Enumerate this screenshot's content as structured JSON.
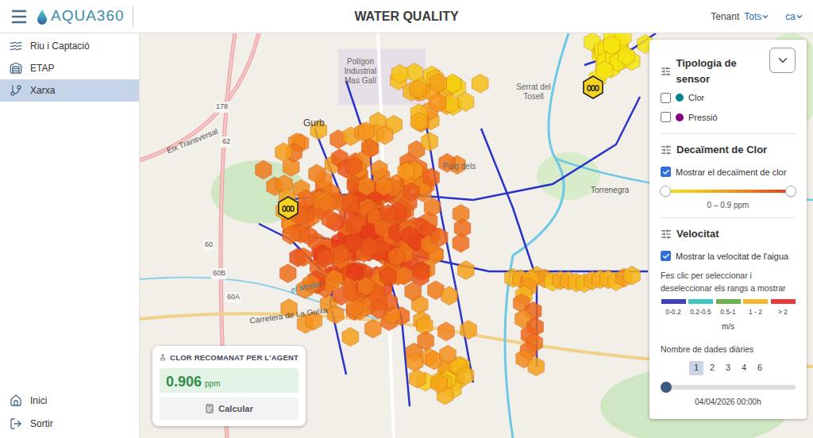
{
  "header": {
    "logo": "AQUA360",
    "title": "WATER QUALITY",
    "tenant_label": "Tenant",
    "tenant_value": "Tots",
    "language": "ca"
  },
  "sidebar": {
    "items": [
      {
        "label": "Riu i Captació",
        "selected": false
      },
      {
        "label": "ETAP",
        "selected": false
      },
      {
        "label": "Xarxa",
        "selected": true
      }
    ],
    "bottom_items": [
      {
        "label": "Inici"
      },
      {
        "label": "Sortir"
      }
    ]
  },
  "map": {
    "labels": [
      "Gurb",
      "Polígon Industrial Mas Galí",
      "Serrat del Tosell",
      "Puig dels",
      "Torrenegra",
      "Eix Transversal",
      "el Meder",
      "Carretera de La Guixa",
      "178",
      "62",
      "60",
      "60B",
      "60A"
    ]
  },
  "filter_panel": {
    "sensor_type": {
      "title": "Tipologia de sensor",
      "options": [
        {
          "label": "Clor",
          "checked": false,
          "color": "#00868b"
        },
        {
          "label": "Pressió",
          "checked": false,
          "color": "#800080"
        }
      ]
    },
    "chlorine_decay": {
      "title": "Decaïment de Clor",
      "checkbox": {
        "label": "Mostrar el decaïment de clor",
        "checked": true
      },
      "range": {
        "level_low": 0,
        "level_high": 1,
        "reading": "0 – 0.9 ppm"
      }
    },
    "velocity": {
      "title": "Velocitat",
      "checkbox": {
        "label": "Mostrar la velocitat de l'aigua",
        "checked": true
      },
      "hint": "Fes clic per seleccionar i deseleccionar els rangs a mostrar",
      "ranges": [
        {
          "label": "0-0.2",
          "color": "#3f3fbf",
          "selected": true
        },
        {
          "label": "0.2-0.5",
          "color": "#3fc7c7",
          "selected": true
        },
        {
          "label": "0.5-1",
          "color": "#6bb24a",
          "selected": true
        },
        {
          "label": "1 - 2",
          "color": "#f5b731",
          "selected": true
        },
        {
          "label": "> 2",
          "color": "#e83b3b",
          "selected": true
        }
      ],
      "unit": "m/s"
    },
    "daily_data": {
      "title": "Nombre de dades diàries",
      "options": [
        {
          "label": "1",
          "selected": true
        },
        {
          "label": "2",
          "selected": false
        },
        {
          "label": "3",
          "selected": false
        },
        {
          "label": "4",
          "selected": false
        },
        {
          "label": "6",
          "selected": false
        }
      ],
      "slider": {
        "level": 0,
        "reading": "04/04/2026 00:00h"
      }
    }
  },
  "agent_card": {
    "title": "CLOR RECOMANAT PER L'AGENT",
    "value": "0.906",
    "unit": "ppm",
    "button": "Calcular"
  }
}
